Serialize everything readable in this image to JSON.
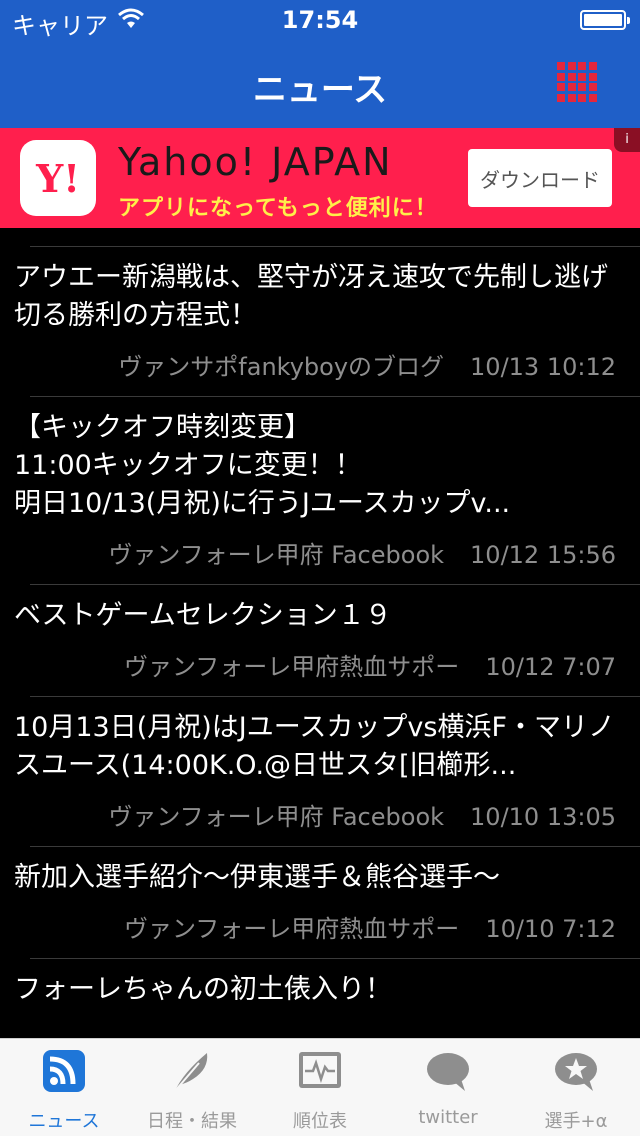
{
  "status_bar": {
    "carrier": "キャリア",
    "time": "17:54"
  },
  "nav": {
    "title": "ニュース",
    "menu_icon": "grid-icon"
  },
  "ad": {
    "logo_text": "Y!",
    "title": "Yahoo! JAPAN",
    "subtitle": "アプリになってもっと便利に！",
    "button": "ダウンロード",
    "info": "i"
  },
  "news": [
    {
      "title": "アウエー新潟戦は、堅守が冴え速攻で先制し逃げ切る勝利の方程式！",
      "source": "ヴァンサポfankyboyのブログ",
      "date": "10/13 10:12"
    },
    {
      "title": "【キックオフ時刻変更】\n11:00キックオフに変更！！\n明日10/13(月祝)に行うJユースカップv...",
      "source": "ヴァンフォーレ甲府 Facebook",
      "date": "10/12 15:56"
    },
    {
      "title": "ベストゲームセレクション１９",
      "source": "ヴァンフォーレ甲府熱血サポー",
      "date": "10/12 7:07"
    },
    {
      "title": "10月13日(月祝)はJユースカップvs横浜F・マリノスユース(14:00K.O.@日世スタ[旧櫛形...",
      "source": "ヴァンフォーレ甲府 Facebook",
      "date": "10/10 13:05"
    },
    {
      "title": "新加入選手紹介〜伊東選手＆熊谷選手〜",
      "source": "ヴァンフォーレ甲府熱血サポー",
      "date": "10/10 7:12"
    },
    {
      "title": "フォーレちゃんの初土俵入り！",
      "source": "",
      "date": ""
    }
  ],
  "tabs": [
    {
      "label": "ニュース",
      "icon": "rss-icon",
      "active": true
    },
    {
      "label": "日程・結果",
      "icon": "feather-icon",
      "active": false
    },
    {
      "label": "順位表",
      "icon": "chart-monitor-icon",
      "active": false
    },
    {
      "label": "twitter",
      "icon": "speech-bubble-icon",
      "active": false
    },
    {
      "label": "選手+α",
      "icon": "star-bubble-icon",
      "active": false
    }
  ],
  "colors": {
    "nav": "#1f5fc8",
    "ad": "#ff1f4d",
    "accent": "#1f76d8",
    "grid": "#e5263c"
  }
}
